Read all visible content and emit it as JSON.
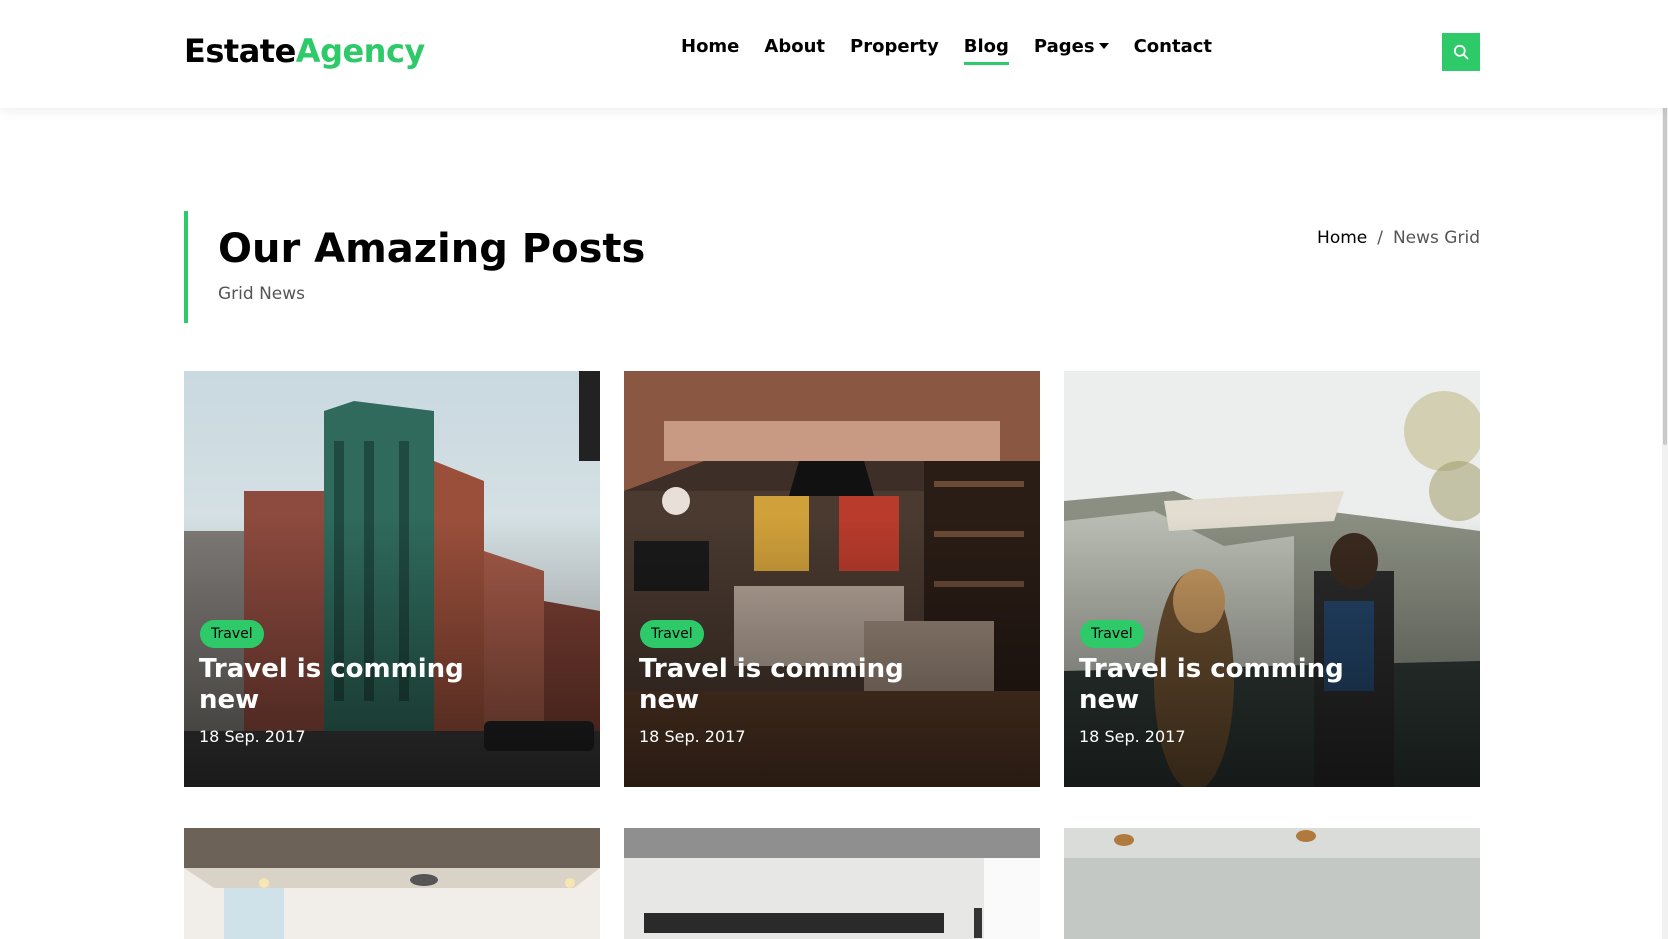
{
  "header": {
    "logo_part1": "Estate",
    "logo_part2": "Agency",
    "nav": [
      {
        "label": "Home"
      },
      {
        "label": "About"
      },
      {
        "label": "Property"
      },
      {
        "label": "Blog",
        "active": true
      },
      {
        "label": "Pages",
        "dropdown": true
      },
      {
        "label": "Contact"
      }
    ],
    "search_icon": "search-icon"
  },
  "intro": {
    "title": "Our Amazing Posts",
    "subtitle": "Grid News",
    "breadcrumb": {
      "home": "Home",
      "separator": "/",
      "current": "News Grid"
    }
  },
  "posts": [
    {
      "category": "Travel",
      "title": "Travel is comming new",
      "date": "18 Sep. 2017",
      "image": "city-building-photo"
    },
    {
      "category": "Travel",
      "title": "Travel is comming new",
      "date": "18 Sep. 2017",
      "image": "living-room-photo"
    },
    {
      "category": "Travel",
      "title": "Travel is comming new",
      "date": "18 Sep. 2017",
      "image": "cliff-travelers-photo"
    }
  ],
  "bottom_posts": [
    {
      "image": "office-interior-photo"
    },
    {
      "image": "kitchen-interior-photo"
    },
    {
      "image": "bright-room-photo"
    }
  ],
  "colors": {
    "accent": "#2eca6a",
    "text": "#000000",
    "muted": "#555555"
  }
}
